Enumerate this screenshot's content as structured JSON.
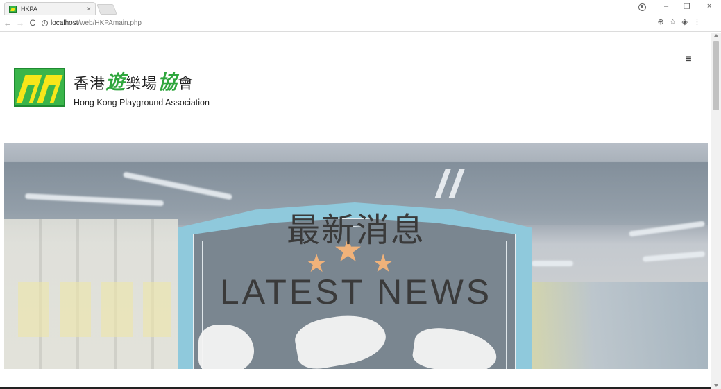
{
  "browser": {
    "tab_title": "HKPA",
    "tab_close": "×",
    "url_host": "localhost",
    "url_path": "/web/HKPAmain.php",
    "back": "←",
    "forward": "→",
    "reload": "C",
    "info": "i",
    "zoom_icon": "⊕",
    "star_icon": "☆",
    "ext_icon": "◈",
    "menu_icon": "⋮",
    "minimize": "–",
    "restore": "❐",
    "close": "×"
  },
  "header": {
    "logo_cn_part1": "香港",
    "logo_cn_green1": "遊",
    "logo_cn_part2": "樂場",
    "logo_cn_green2": "協",
    "logo_cn_part3": "會",
    "logo_en": "Hong Kong Playground Association",
    "menu_icon": "≡"
  },
  "banner": {
    "title_cn": "最新消息",
    "title_en": "LATEST NEWS",
    "star": "★"
  },
  "colors": {
    "brand_green": "#3ab54a",
    "brand_yellow": "#f7e61a"
  }
}
